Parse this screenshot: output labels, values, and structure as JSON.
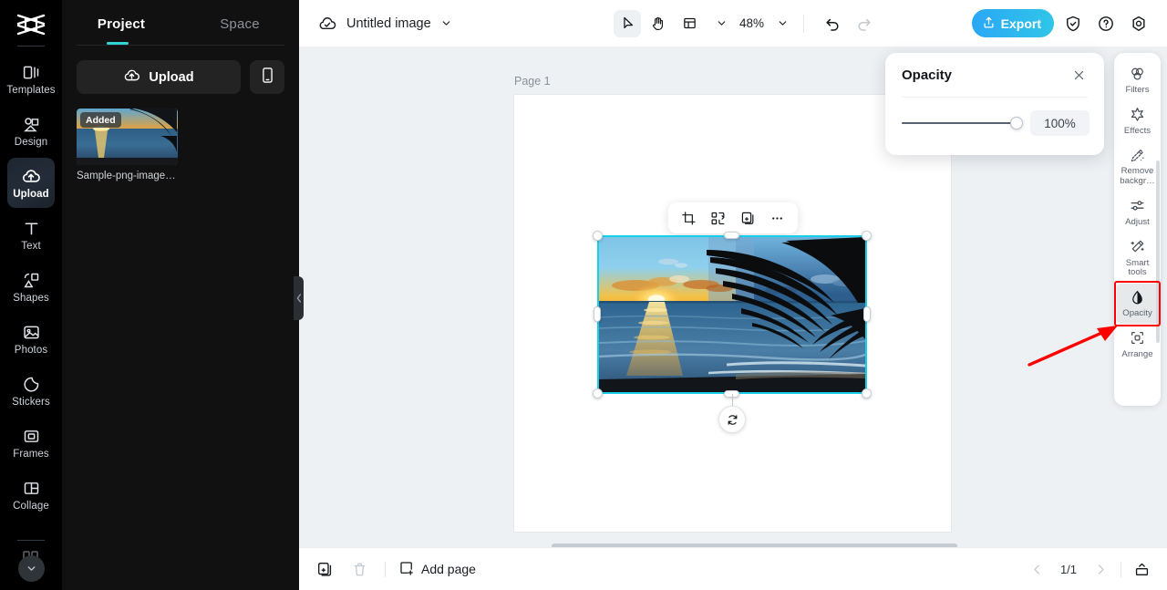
{
  "rail": {
    "logo_icon": "capcut-logo-icon",
    "items": [
      {
        "label": "Templates",
        "icon": "templates-icon",
        "active": false
      },
      {
        "label": "Design",
        "icon": "design-icon",
        "active": false
      },
      {
        "label": "Upload",
        "icon": "upload-cloud-icon",
        "active": true
      },
      {
        "label": "Text",
        "icon": "text-icon",
        "active": false
      },
      {
        "label": "Shapes",
        "icon": "shapes-icon",
        "active": false
      },
      {
        "label": "Photos",
        "icon": "photos-icon",
        "active": false
      },
      {
        "label": "Stickers",
        "icon": "stickers-icon",
        "active": false
      },
      {
        "label": "Frames",
        "icon": "frames-icon",
        "active": false
      },
      {
        "label": "Collage",
        "icon": "collage-icon",
        "active": false
      }
    ],
    "expand_icon": "chevron-down-icon"
  },
  "panel": {
    "tabs": [
      {
        "label": "Project",
        "active": true
      },
      {
        "label": "Space",
        "active": false
      }
    ],
    "accent_color": "#2fd4d4",
    "upload_label": "Upload",
    "upload_icon": "upload-cloud-icon",
    "device_icon": "mobile-device-icon",
    "assets": [
      {
        "badge": "Added",
        "name": "Sample-png-image-1..."
      }
    ],
    "collapse_icon": "chevron-left-icon"
  },
  "topbar": {
    "cloud_icon": "cloud-saved-icon",
    "doc_title": "Untitled image",
    "title_caret_icon": "chevron-down-icon",
    "tools": [
      {
        "name": "select-tool",
        "icon": "cursor-arrow-icon",
        "selected": true
      },
      {
        "name": "hand-tool",
        "icon": "hand-icon",
        "selected": false
      },
      {
        "name": "layout-tool",
        "icon": "layout-panel-icon",
        "selected": false
      }
    ],
    "layout_caret_icon": "chevron-down-icon",
    "zoom_level": "48%",
    "zoom_caret_icon": "chevron-down-icon",
    "undo_icon": "undo-icon",
    "redo_icon": "redo-icon",
    "export_label": "Export",
    "export_icon": "export-upload-icon",
    "export_color": "#2fbae9",
    "shield_icon": "shield-check-icon",
    "help_icon": "question-circle-icon",
    "settings_icon": "settings-gear-icon"
  },
  "canvas": {
    "page_label": "Page 1",
    "float_toolbar": [
      {
        "name": "crop-button",
        "icon": "crop-icon"
      },
      {
        "name": "replace-button",
        "icon": "replace-shuffle-icon"
      },
      {
        "name": "duplicate-button",
        "icon": "duplicate-plus-icon"
      },
      {
        "name": "more-button",
        "icon": "more-horizontal-icon"
      }
    ],
    "selection_color": "#17cfe8",
    "rotate_icon": "rotate-icon"
  },
  "opacity_popup": {
    "title": "Opacity",
    "close_icon": "close-x-icon",
    "value": "100%",
    "slider_percent": 100
  },
  "right_sidebar": {
    "items": [
      {
        "label": "Filters",
        "icon": "filters-circles-icon",
        "highlight": false
      },
      {
        "label": "Effects",
        "icon": "effects-star-icon",
        "highlight": false
      },
      {
        "label": "Remove backgr…",
        "icon": "remove-background-icon",
        "highlight": false
      },
      {
        "label": "Adjust",
        "icon": "adjust-sliders-icon",
        "highlight": false
      },
      {
        "label": "Smart tools",
        "icon": "smart-wand-icon",
        "highlight": false
      },
      {
        "label": "Opacity",
        "icon": "opacity-droplet-icon",
        "highlight": true
      },
      {
        "label": "Arrange",
        "icon": "arrange-icon",
        "highlight": false
      }
    ],
    "annotation_color": "#ff0000"
  },
  "bottombar": {
    "duplicate_page_icon": "duplicate-page-icon",
    "delete_page_icon": "trash-icon",
    "add_page_label": "Add page",
    "add_page_icon": "add-page-icon",
    "prev_icon": "chevron-left-icon",
    "page_indicator": "1/1",
    "next_icon": "chevron-right-icon",
    "pages_panel_icon": "pages-panel-icon"
  }
}
